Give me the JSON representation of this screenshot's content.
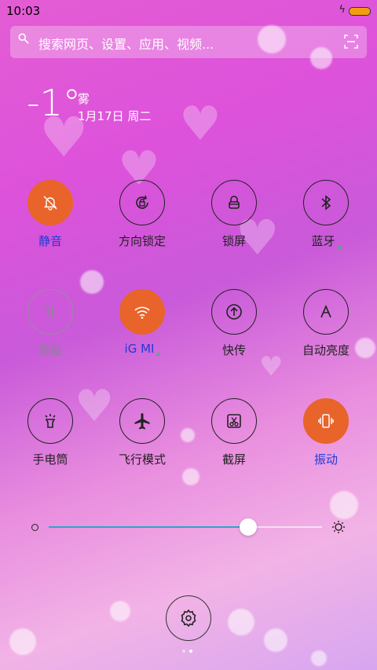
{
  "status": {
    "time": "10:03"
  },
  "search": {
    "placeholder": "搜索网页、设置、应用、视频..."
  },
  "weather": {
    "temp": "-1°",
    "condition": "雾",
    "date": "1月17日 周二"
  },
  "tiles": [
    {
      "label": "静音",
      "state": "active",
      "icon": "bell-off-icon"
    },
    {
      "label": "方向锁定",
      "state": "normal",
      "icon": "rotation-lock-icon"
    },
    {
      "label": "锁屏",
      "state": "normal",
      "icon": "lock-icon"
    },
    {
      "label": "蓝牙",
      "state": "normal",
      "icon": "bluetooth-icon",
      "indicator": true
    },
    {
      "label": "数据",
      "state": "dim",
      "icon": "mobile-data-icon"
    },
    {
      "label": "іG  MI",
      "state": "active",
      "icon": "wifi-icon",
      "indicator": true
    },
    {
      "label": "快传",
      "state": "normal",
      "icon": "transfer-icon"
    },
    {
      "label": "自动亮度",
      "state": "normal",
      "icon": "auto-brightness-icon"
    },
    {
      "label": "手电筒",
      "state": "normal",
      "icon": "flashlight-icon"
    },
    {
      "label": "飞行模式",
      "state": "normal",
      "icon": "airplane-icon"
    },
    {
      "label": "截屏",
      "state": "normal",
      "icon": "screenshot-icon"
    },
    {
      "label": "振动",
      "state": "active",
      "icon": "vibrate-icon"
    }
  ],
  "brightness": {
    "value": 0.73
  },
  "pages": {
    "count": 2,
    "current": 1
  },
  "colors": {
    "active": "#e8642a",
    "active_label": "#1e3bd6",
    "slider_fill": "#2ca6c9"
  }
}
